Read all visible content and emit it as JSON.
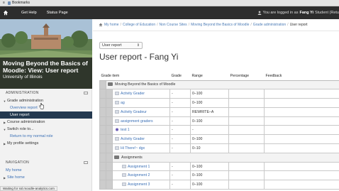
{
  "browser": {
    "bookmarks_label": "Bookmarks"
  },
  "navbar": {
    "get_help": "Get Help",
    "status_page": "Status Page",
    "logged_in_prefix": "You are logged in as",
    "user_name": "Fang Yi",
    "role": "Student",
    "logout_partial": "(Retu"
  },
  "course": {
    "title": "Moving Beyond the Basics of Moodle: View: User report",
    "institution": "University of Illinois"
  },
  "admin_block": {
    "heading": "ADMINISTRATION",
    "grade_admin": "Grade administration",
    "overview": "Overview report",
    "user_report": "User report",
    "course_admin": "Course administration",
    "switch_role": "Switch role to...",
    "return_role": "Return to my normal role",
    "profile": "My profile settings"
  },
  "nav_block": {
    "heading": "NAVIGATION",
    "my_home": "My home",
    "site_home": "Site home"
  },
  "breadcrumb": [
    "My home",
    "College of Education",
    "Non Course Sites",
    "Moving Beyond the Basics of Moodle",
    "Grade administration",
    "User report"
  ],
  "report_select": {
    "value": "User report"
  },
  "page_title": "User report - Fang Yi",
  "table": {
    "headers": [
      "Grade item",
      "Grade",
      "Range",
      "Percentage",
      "Feedback"
    ],
    "top_category": "Moving Beyond the Basics of Moodle",
    "rows": [
      {
        "name": "Activity Grader",
        "grade": "-",
        "range": "0–100"
      },
      {
        "name": "ag",
        "grade": "-",
        "range": "0–100"
      },
      {
        "name": "Activity Gradeur",
        "grade": "-",
        "range": "REWRITE–A"
      },
      {
        "name": "assignment graders",
        "grade": "-",
        "range": "0–100"
      },
      {
        "name": "test 1",
        "grade": "-",
        "range": "-"
      },
      {
        "name": "Activity Grader",
        "grade": "-",
        "range": "0–100"
      },
      {
        "name": "Hi There!~ dgx",
        "grade": "-",
        "range": "0–10"
      }
    ],
    "sub_category": "Assignments",
    "sub_rows": [
      {
        "name": "Assignment 1",
        "grade": "-",
        "range": "0–100"
      },
      {
        "name": "Assignment 2",
        "grade": "-",
        "range": "0–100"
      },
      {
        "name": "Assignment 3",
        "grade": "-",
        "range": "0–100"
      }
    ]
  },
  "status_bar": "Waiting for ssl.moodle-analytics.com"
}
